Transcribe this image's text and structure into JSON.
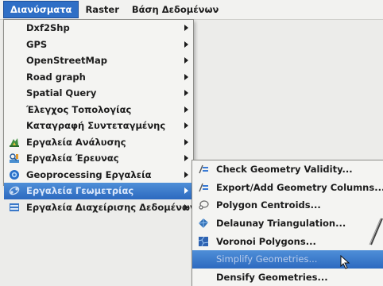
{
  "menubar": {
    "items": [
      "Διανύσματα",
      "Raster",
      "Βάση Δεδομένων"
    ]
  },
  "main_menu": {
    "items": [
      {
        "label": "Dxf2Shp"
      },
      {
        "label": "GPS"
      },
      {
        "label": "OpenStreetMap"
      },
      {
        "label": "Road graph"
      },
      {
        "label": "Spatial Query"
      },
      {
        "label": "Έλεγχος Τοπολογίας"
      },
      {
        "label": "Καταγραφή Συντεταγμένης"
      },
      {
        "label": "Εργαλεία Ανάλυσης",
        "icon": "analysis-icon"
      },
      {
        "label": "Εργαλεία Έρευνας",
        "icon": "research-icon"
      },
      {
        "label": "Geoprocessing Εργαλεία",
        "icon": "geoprocessing-icon"
      },
      {
        "label": "Εργαλεία Γεωμετρίας",
        "icon": "geometry-icon",
        "highlighted": true
      },
      {
        "label": "Εργαλεία Διαχείρισης Δεδομένων",
        "icon": "data-management-icon"
      }
    ]
  },
  "submenu": {
    "items": [
      {
        "label": "Check Geometry Validity...",
        "icon": "check-geometry-icon"
      },
      {
        "label": "Export/Add Geometry Columns...",
        "icon": "export-geometry-icon"
      },
      {
        "label": "Polygon Centroids...",
        "icon": "polygon-centroids-icon"
      },
      {
        "label": "Delaunay Triangulation...",
        "icon": "delaunay-icon"
      },
      {
        "label": "Voronoi Polygons...",
        "icon": "voronoi-icon"
      },
      {
        "label": "Simplify Geometries...",
        "icon": "simplify-icon",
        "highlighted": true
      },
      {
        "label": "Densify Geometries...",
        "icon": "densify-icon"
      }
    ]
  },
  "colors": {
    "highlight": "#2f6fc6",
    "menu_bg": "#f4f4f2"
  }
}
